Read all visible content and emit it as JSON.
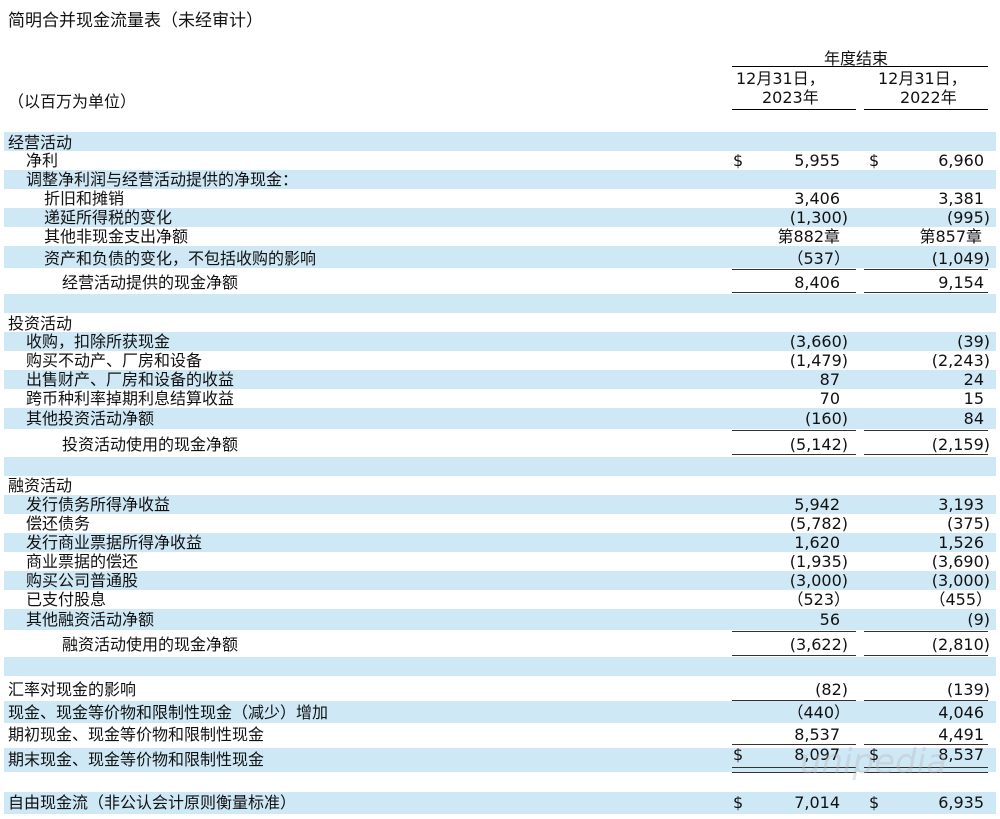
{
  "title": "简明合并现金流量表（未经审计）",
  "header": {
    "units": "（以百万为单位）",
    "year_end": "年度结束",
    "col1_line1": "12月31日，",
    "col1_line2": "2023年",
    "col2_line1": "12月31日，",
    "col2_line2": "2022年"
  },
  "operating": {
    "heading": "经营活动",
    "net_income": {
      "label": "净利",
      "dollar": "$",
      "v2023": "5,955",
      "v2022": "6,960"
    },
    "adjust_label": "调整净利润与经营活动提供的净现金：",
    "depreciation": {
      "label": "折旧和摊销",
      "v2023": "3,406",
      "v2022": "3,381"
    },
    "deferred_tax": {
      "label": "递延所得税的变化",
      "v2023": "(1,300)",
      "v2022": "(995)"
    },
    "other_noncash": {
      "label": "其他非现金支出净额",
      "v2023": "第882章",
      "v2022": "第857章"
    },
    "working_capital": {
      "label": "资产和负债的变化，不包括收购的影响",
      "v2023": "（537）",
      "v2022": "(1,049)"
    },
    "total": {
      "label": "经营活动提供的现金净额",
      "v2023": "8,406",
      "v2022": "9,154"
    }
  },
  "investing": {
    "heading": "投资活动",
    "acquisitions": {
      "label": "收购，扣除所获现金",
      "v2023": "(3,660)",
      "v2022": "(39)"
    },
    "ppe_purchase": {
      "label": "购买不动产、厂房和设备",
      "v2023": "(1,479)",
      "v2022": "(2,243)"
    },
    "ppe_sale": {
      "label": "出售财产、厂房和设备的收益",
      "v2023": "87",
      "v2022": "24"
    },
    "swaps": {
      "label": "跨币种利率掉期利息结算收益",
      "v2023": "70",
      "v2022": "15"
    },
    "other": {
      "label": "其他投资活动净额",
      "v2023": "(160)",
      "v2022": "84"
    },
    "total": {
      "label": "投资活动使用的现金净额",
      "v2023": "(5,142)",
      "v2022": "(2,159)"
    }
  },
  "financing": {
    "heading": "融资活动",
    "debt_proceeds": {
      "label": "发行债务所得净收益",
      "v2023": "5,942",
      "v2022": "3,193"
    },
    "debt_repay": {
      "label": "偿还债务",
      "v2023": "(5,782)",
      "v2022": "(375)"
    },
    "cp_proceeds": {
      "label": "发行商业票据所得净收益",
      "v2023": "1,620",
      "v2022": "1,526"
    },
    "cp_repay": {
      "label": "商业票据的偿还",
      "v2023": "(1,935)",
      "v2022": "(3,690)"
    },
    "buyback": {
      "label": "购买公司普通股",
      "v2023": "(3,000)",
      "v2022": "(3,000)"
    },
    "dividends": {
      "label": "已支付股息",
      "v2023": "（523）",
      "v2022": "（455）"
    },
    "other": {
      "label": "其他融资活动净额",
      "v2023": "56",
      "v2022": "(9)"
    },
    "total": {
      "label": "融资活动使用的现金净额",
      "v2023": "(3,622)",
      "v2022": "(2,810)"
    }
  },
  "summary": {
    "fx": {
      "label": "汇率对现金的影响",
      "v2023": "(82)",
      "v2022": "(139)"
    },
    "change": {
      "label": "现金、现金等价物和限制性现金（减少）增加",
      "v2023": "（440）",
      "v2022": "4,046"
    },
    "beginning": {
      "label": "期初现金、现金等价物和限制性现金",
      "v2023": "8,537",
      "v2022": "4,491"
    },
    "ending": {
      "label": "期末现金、现金等价物和限制性现金",
      "dollar": "$",
      "v2023": "8,097",
      "v2022": "8,537"
    },
    "fcf": {
      "label": "自由现金流（非公认会计原则衡量标准）",
      "dollar": "$",
      "v2023": "7,014",
      "v2022": "6,935"
    }
  },
  "watermark": "unipedia",
  "colors": {
    "band": "#cfe8f5",
    "text": "#111111"
  }
}
